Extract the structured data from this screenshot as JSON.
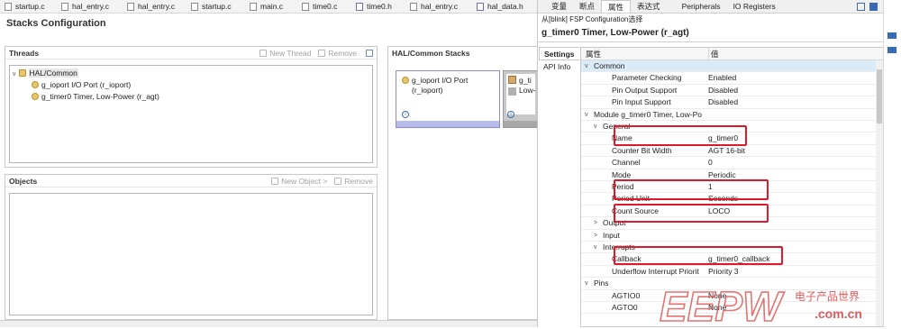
{
  "editor_tabs": [
    {
      "label": "startup.c",
      "type": "c"
    },
    {
      "label": "hal_entry.c",
      "type": "c"
    },
    {
      "label": "hal_entry.c",
      "type": "c"
    },
    {
      "label": "startup.c",
      "type": "c"
    },
    {
      "label": "main.c",
      "type": "c"
    },
    {
      "label": "time0.c",
      "type": "c"
    },
    {
      "label": "time0.h",
      "type": "h"
    },
    {
      "label": "hal_entry.c",
      "type": "c"
    },
    {
      "label": "hal_data.h",
      "type": "h"
    }
  ],
  "stacks_title": "Stacks Configuration",
  "threads": {
    "title": "Threads",
    "new_thread": "New Thread",
    "remove": "Remove",
    "root": "HAL/Common",
    "items": [
      "g_ioport I/O Port (r_ioport)",
      "g_timer0 Timer, Low-Power (r_agt)"
    ]
  },
  "hal_stacks": {
    "title": "HAL/Common Stacks",
    "card1_line1": "g_ioport I/O Port",
    "card1_line2": "(r_ioport)",
    "card2_line1": "g_ti",
    "card2_line2": "Low-"
  },
  "objects": {
    "title": "Objects",
    "new_object": "New Object >",
    "remove": "Remove"
  },
  "right_tabs": [
    "变量",
    "断点",
    "属性",
    "表达式",
    "Peripherals",
    "IO Registers"
  ],
  "breadcrumb": "从[blink] FSP Configuration选择",
  "prop_title": "g_timer0 Timer, Low-Power (r_agt)",
  "side_tabs": [
    "Settings",
    "API Info"
  ],
  "prop_header": {
    "key": "属性",
    "value": "值"
  },
  "props": [
    {
      "key": "Common",
      "value": "",
      "indent": 0,
      "arrow": "v",
      "hl": true
    },
    {
      "key": "Parameter Checking",
      "value": "Enabled",
      "indent": 2
    },
    {
      "key": "Pin Output Support",
      "value": "Disabled",
      "indent": 2
    },
    {
      "key": "Pin Input Support",
      "value": "Disabled",
      "indent": 2
    },
    {
      "key": "Module g_timer0 Timer, Low-Po",
      "value": "",
      "indent": 0,
      "arrow": "v"
    },
    {
      "key": "General",
      "value": "",
      "indent": 1,
      "arrow": "v"
    },
    {
      "key": "Name",
      "value": "g_timer0",
      "indent": 2
    },
    {
      "key": "Counter Bit Width",
      "value": "AGT 16-bit",
      "indent": 2
    },
    {
      "key": "Channel",
      "value": "0",
      "indent": 2
    },
    {
      "key": "Mode",
      "value": "Periodic",
      "indent": 2
    },
    {
      "key": "Period",
      "value": "1",
      "indent": 2
    },
    {
      "key": "Period Unit",
      "value": "Seconds",
      "indent": 2
    },
    {
      "key": "Count Source",
      "value": "LOCO",
      "indent": 2
    },
    {
      "key": "Output",
      "value": "",
      "indent": 1,
      "arrow": ">"
    },
    {
      "key": "Input",
      "value": "",
      "indent": 1,
      "arrow": ">"
    },
    {
      "key": "Interrupts",
      "value": "",
      "indent": 1,
      "arrow": "v"
    },
    {
      "key": "Callback",
      "value": "g_timer0_callback",
      "indent": 2
    },
    {
      "key": "Underflow Interrupt Priorit",
      "value": "Priority 3",
      "indent": 2
    },
    {
      "key": "Pins",
      "value": "",
      "indent": 0,
      "arrow": "v"
    },
    {
      "key": "AGTIO0",
      "value": "None",
      "indent": 2
    },
    {
      "key": "AGTO0",
      "value": "None",
      "indent": 2
    }
  ],
  "watermark": {
    "logo": "EEPW",
    "cn": "电子产品世界",
    "domain": ".com.cn"
  },
  "colors": {
    "highlight": "#dbeaf7",
    "red_box": "#e0182c",
    "card_border": "#8a8ec8",
    "watermark": "#e05a5a"
  }
}
